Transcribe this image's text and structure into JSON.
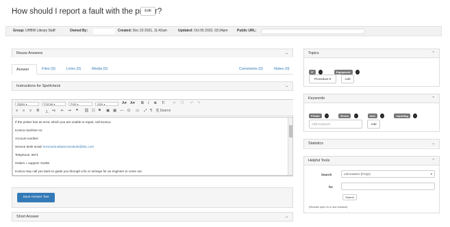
{
  "header": {
    "title": "How should I report a fault with the printer?",
    "edit_label": "Edit"
  },
  "meta": {
    "group_label": "Group:",
    "group_value": "UHBW Library Staff",
    "owned_label": "Owned By:",
    "created_label": "Created:",
    "created_value": "Dec 23 2021, 11:42am",
    "updated_label": "Updated:",
    "updated_value": "Oct 05 2022, 03:34pm",
    "url_label": "Public URL:"
  },
  "reuse": {
    "label": "Reuse Answers"
  },
  "tabs": [
    {
      "label": "Answer"
    },
    {
      "label": "Files (0)"
    },
    {
      "label": "Links (0)"
    },
    {
      "label": "Media (0)"
    },
    {
      "label": "Comments (0)"
    },
    {
      "label": "Notes (0)"
    }
  ],
  "spellcheck": {
    "label": "Instructions for Spellcheck"
  },
  "toolbar": {
    "styles": "Styles",
    "format": "Format",
    "font": "Font",
    "size": "Size",
    "source": "Source"
  },
  "editor": {
    "lines": [
      "If the printer has an error, which you are unable to repair, call Konica:",
      "Konica machine no:",
      "Account number:",
      "Service desk email: ",
      "Telephone: 0871",
      "Orders + support: 01265",
      "Konica may call you back to guide you through a fix or arrange for an engineer to come out."
    ],
    "email": "konicaminoltaservicedesk@sbc.com"
  },
  "save": {
    "label": "Save Answer Text"
  },
  "short_answer": {
    "label": "Short Answer"
  },
  "topics": {
    "label": "Topics",
    "tags": [
      "IT",
      "Equipment"
    ],
    "procedure": "Procedure ▾",
    "add": "Add"
  },
  "keywords": {
    "label": "Keywords",
    "tags": [
      "Printer",
      "Errors",
      "tech",
      "reporting"
    ],
    "placeholder": "Add Keyword",
    "add": "Add"
  },
  "statistics": {
    "label": "Statistics"
  },
  "helpful": {
    "label": "Helpful Tools",
    "search_label": "Search",
    "search_value": "LibAnswers (FAQs)",
    "for_label": "for",
    "button": "Search",
    "note": "(Results open in a new window)"
  }
}
